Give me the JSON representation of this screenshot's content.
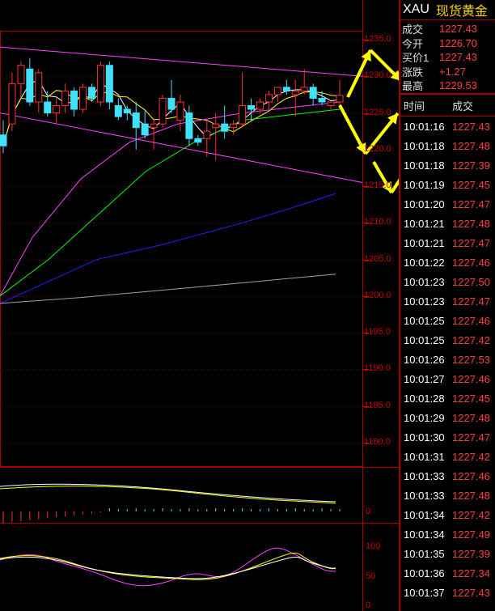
{
  "header": {
    "symbol": "XAU",
    "name": "现货黄金"
  },
  "quote": [
    {
      "label": "成交",
      "value": "1227.43"
    },
    {
      "label": "今开",
      "value": "1226.70"
    },
    {
      "label": "买价1",
      "value": "1227.43"
    },
    {
      "label": "涨跌",
      "value": "+1.27"
    },
    {
      "label": "最高",
      "value": "1229.53"
    }
  ],
  "ticks_header": {
    "time": "时间",
    "price": "成交"
  },
  "ticks": [
    {
      "time": "10:01:16",
      "price": "1227.43"
    },
    {
      "time": "10:01:18",
      "price": "1227.48"
    },
    {
      "time": "10:01:18",
      "price": "1227.39"
    },
    {
      "time": "10:01:19",
      "price": "1227.45"
    },
    {
      "time": "10:01:20",
      "price": "1227.47"
    },
    {
      "time": "10:01:21",
      "price": "1227.48"
    },
    {
      "time": "10:01:21",
      "price": "1227.47"
    },
    {
      "time": "10:01:22",
      "price": "1227.46"
    },
    {
      "time": "10:01:23",
      "price": "1227.50"
    },
    {
      "time": "10:01:23",
      "price": "1227.47"
    },
    {
      "time": "10:01:25",
      "price": "1227.46"
    },
    {
      "time": "10:01:25",
      "price": "1227.42"
    },
    {
      "time": "10:01:26",
      "price": "1227.53"
    },
    {
      "time": "10:01:27",
      "price": "1227.46"
    },
    {
      "time": "10:01:28",
      "price": "1227.45"
    },
    {
      "time": "10:01:29",
      "price": "1227.48"
    },
    {
      "time": "10:01:30",
      "price": "1227.47"
    },
    {
      "time": "10:01:31",
      "price": "1227.42"
    },
    {
      "time": "10:01:33",
      "price": "1227.46"
    },
    {
      "time": "10:01:33",
      "price": "1227.48"
    },
    {
      "time": "10:01:34",
      "price": "1227.42"
    },
    {
      "time": "10:01:34",
      "price": "1227.49"
    },
    {
      "time": "10:01:35",
      "price": "1227.39"
    },
    {
      "time": "10:01:36",
      "price": "1227.34"
    },
    {
      "time": "10:01:37",
      "price": "1227.43"
    }
  ],
  "price_axis": [
    "1235.0",
    "1230.0",
    "1225.0",
    "1220.0",
    "1215.0",
    "1210.0",
    "1205.0",
    "1200.0",
    "1195.0",
    "1190.0",
    "1185.0",
    "1180.0"
  ],
  "macd_axis": [
    "0"
  ],
  "osc_axis": [
    "100",
    "50",
    "0"
  ],
  "colors": {
    "up": "#ff3030",
    "down": "#40e0ff",
    "ma5": "#ffffff",
    "ma10": "#ffff00",
    "ma20": "#ff40ff",
    "ma40": "#00ff00",
    "ma60": "#2020ff",
    "ma120": "#a0a0a0",
    "channel": "#ff40ff",
    "arrow": "#ffff00"
  },
  "chart_data": {
    "type": "candlestick",
    "ylim": [
      1177,
      1236
    ],
    "candles": [
      {
        "o": 1222,
        "h": 1224,
        "l": 1219.5,
        "c": 1220.5
      },
      {
        "o": 1223.5,
        "h": 1230.5,
        "l": 1222.5,
        "c": 1229
      },
      {
        "o": 1229,
        "h": 1232,
        "l": 1227,
        "c": 1231.5
      },
      {
        "o": 1231,
        "h": 1232.5,
        "l": 1226,
        "c": 1226.5
      },
      {
        "o": 1226.5,
        "h": 1231,
        "l": 1225,
        "c": 1230.5
      },
      {
        "o": 1226.5,
        "h": 1228,
        "l": 1224.5,
        "c": 1225
      },
      {
        "o": 1225,
        "h": 1227,
        "l": 1223.5,
        "c": 1226
      },
      {
        "o": 1226,
        "h": 1229,
        "l": 1225,
        "c": 1228
      },
      {
        "o": 1228,
        "h": 1228.5,
        "l": 1224.5,
        "c": 1225.5
      },
      {
        "o": 1225.5,
        "h": 1229,
        "l": 1225,
        "c": 1228.5
      },
      {
        "o": 1228.5,
        "h": 1229,
        "l": 1226.5,
        "c": 1227
      },
      {
        "o": 1226.5,
        "h": 1232,
        "l": 1226,
        "c": 1231.5
      },
      {
        "o": 1231.5,
        "h": 1232,
        "l": 1225.5,
        "c": 1226.5
      },
      {
        "o": 1226,
        "h": 1227,
        "l": 1224,
        "c": 1224.5
      },
      {
        "o": 1225.5,
        "h": 1226,
        "l": 1224,
        "c": 1225
      },
      {
        "o": 1225,
        "h": 1226.5,
        "l": 1220,
        "c": 1223
      },
      {
        "o": 1223.5,
        "h": 1225.5,
        "l": 1221.5,
        "c": 1222
      },
      {
        "o": 1223,
        "h": 1224,
        "l": 1220,
        "c": 1223.5
      },
      {
        "o": 1223.5,
        "h": 1227.5,
        "l": 1223,
        "c": 1227
      },
      {
        "o": 1227,
        "h": 1229.5,
        "l": 1225,
        "c": 1225.5
      },
      {
        "o": 1224,
        "h": 1227.5,
        "l": 1222.5,
        "c": 1226.5
      },
      {
        "o": 1225,
        "h": 1226,
        "l": 1220.5,
        "c": 1221.5
      },
      {
        "o": 1221.5,
        "h": 1222,
        "l": 1220.5,
        "c": 1221
      },
      {
        "o": 1221.5,
        "h": 1224,
        "l": 1219,
        "c": 1222.5
      },
      {
        "o": 1223,
        "h": 1225,
        "l": 1218.5,
        "c": 1223.5
      },
      {
        "o": 1223.5,
        "h": 1226,
        "l": 1221.5,
        "c": 1222.5
      },
      {
        "o": 1223,
        "h": 1224,
        "l": 1222,
        "c": 1223.5
      },
      {
        "o": 1223.5,
        "h": 1230.5,
        "l": 1223,
        "c": 1226
      },
      {
        "o": 1226,
        "h": 1227,
        "l": 1224,
        "c": 1225.5
      },
      {
        "o": 1225.5,
        "h": 1227,
        "l": 1225,
        "c": 1226.5
      },
      {
        "o": 1226.5,
        "h": 1228,
        "l": 1225.5,
        "c": 1227.5
      },
      {
        "o": 1227.5,
        "h": 1228.5,
        "l": 1226.5,
        "c": 1228.5
      },
      {
        "o": 1228.5,
        "h": 1229.5,
        "l": 1227.5,
        "c": 1228
      },
      {
        "o": 1227.5,
        "h": 1229.5,
        "l": 1224.5,
        "c": 1228
      },
      {
        "o": 1228,
        "h": 1231,
        "l": 1227.5,
        "c": 1228.5
      },
      {
        "o": 1228.5,
        "h": 1229,
        "l": 1226,
        "c": 1227
      },
      {
        "o": 1227,
        "h": 1228,
        "l": 1226,
        "c": 1226.5
      },
      {
        "o": 1226,
        "h": 1226.5,
        "l": 1225.5,
        "c": 1226.5
      },
      {
        "o": 1226.5,
        "h": 1229.5,
        "l": 1225.5,
        "c": 1227.4
      }
    ]
  }
}
